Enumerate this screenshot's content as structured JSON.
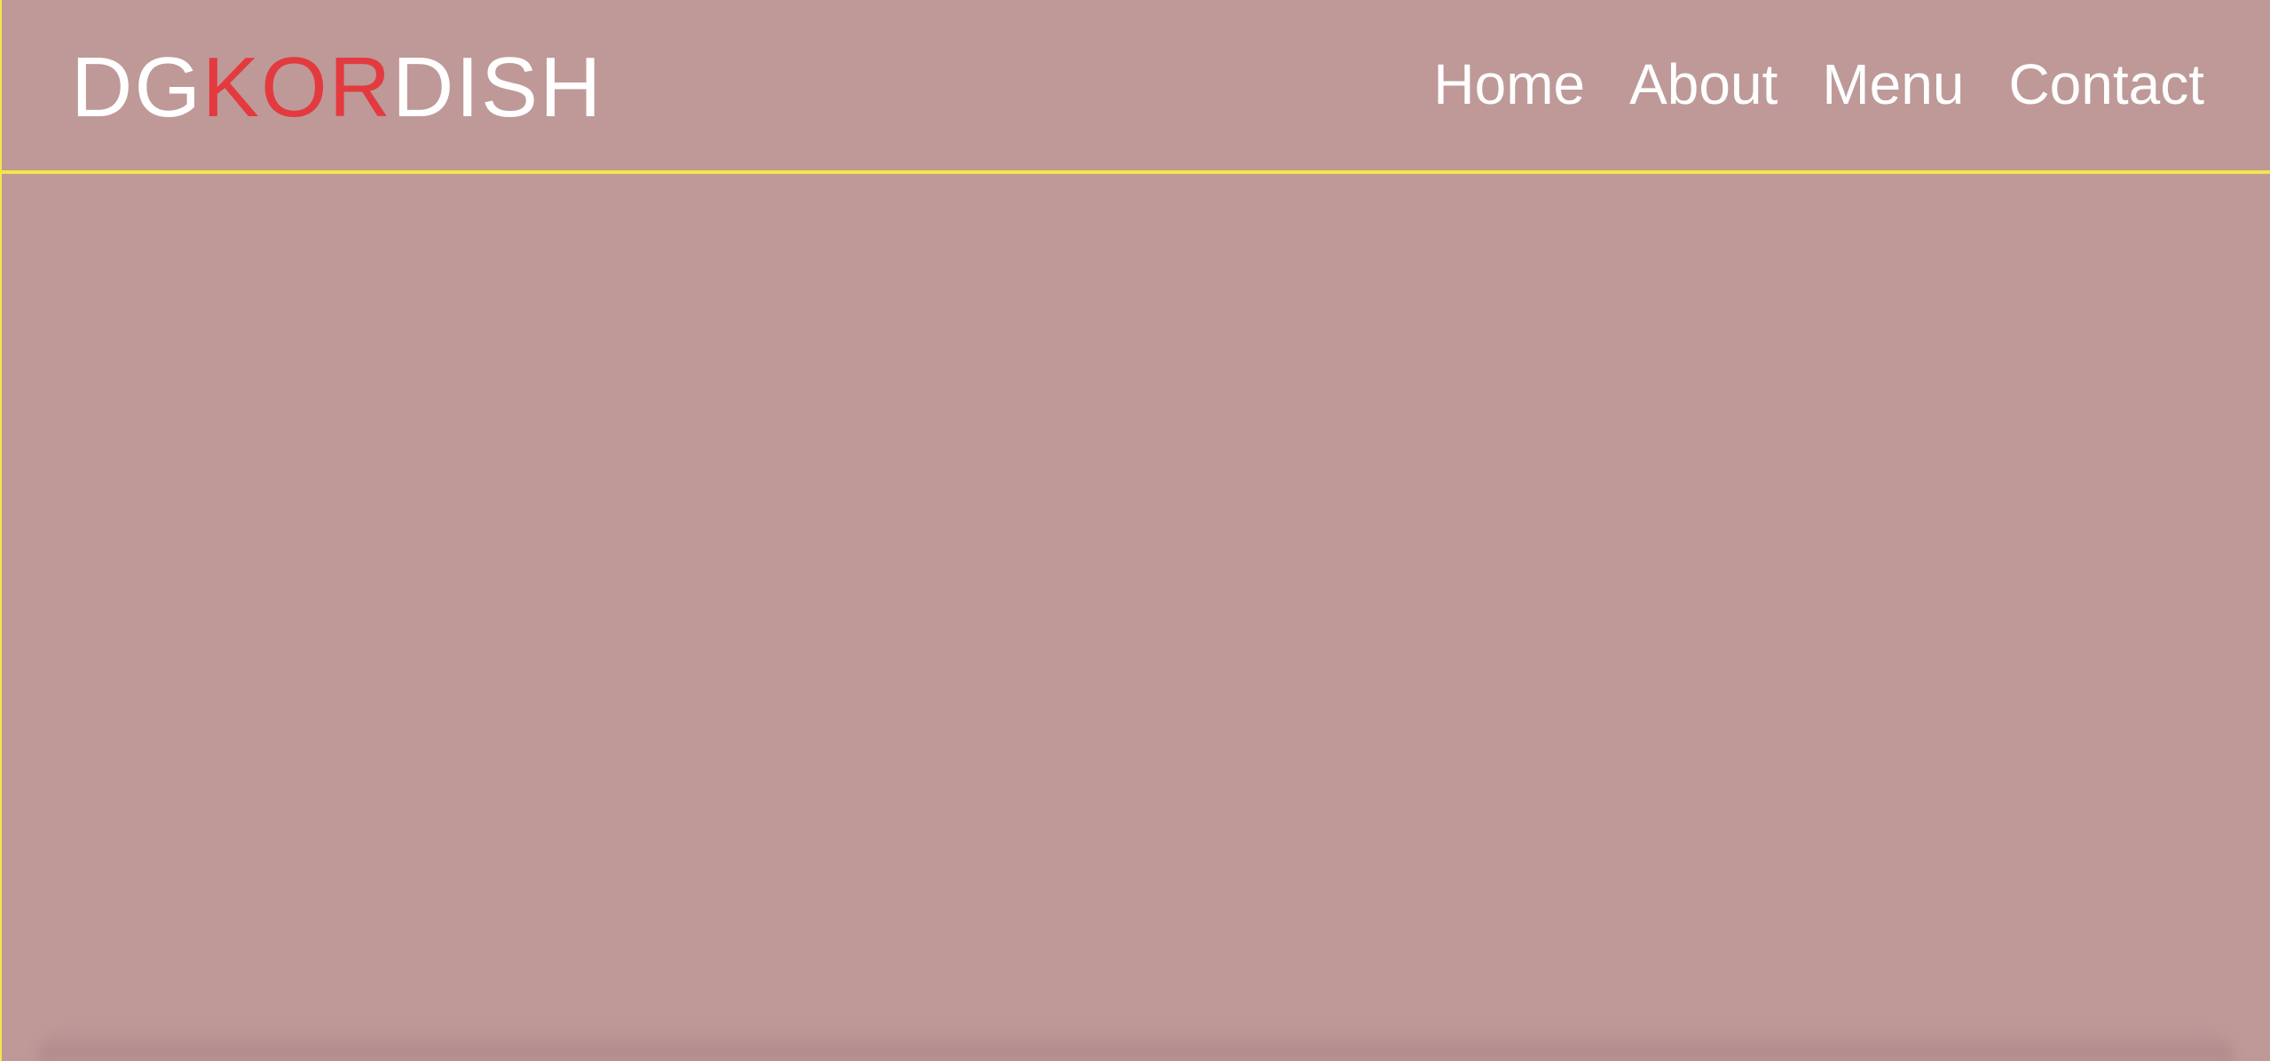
{
  "header": {
    "logo": {
      "prefix": "DG",
      "highlight": "KOR",
      "suffix": "DISH"
    },
    "nav": [
      {
        "label": "Home"
      },
      {
        "label": "About"
      },
      {
        "label": "Menu"
      },
      {
        "label": "Contact"
      }
    ]
  },
  "colors": {
    "background": "#be9998",
    "divider": "#f2e64a",
    "text": "#ffffff",
    "accent": "#e33a40"
  }
}
